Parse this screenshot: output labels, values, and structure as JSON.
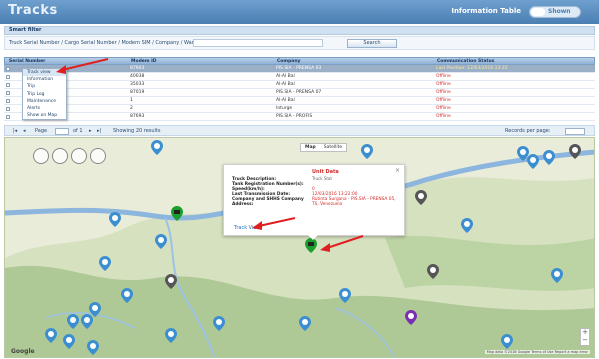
{
  "header": {
    "title": "Tracks",
    "right_label": "Information Table",
    "toggle_label": "Shown"
  },
  "search": {
    "section_title": "Smart filter",
    "label": "Truck Serial Number / Cargo Serial Number / Modem SIM / Company / Warehouse:",
    "value": "",
    "button_label": "Search"
  },
  "table": {
    "columns": [
      "Serial Number",
      "Modem ID",
      "Company",
      "Communication Status"
    ],
    "rows": [
      {
        "id": "1",
        "serial": "",
        "modem": "87903",
        "company": "PIS.SIA - PRENSA 03",
        "status": "Last Position: 12/03/2016 13:22",
        "selected": true
      },
      {
        "id": "2",
        "serial": "",
        "modem": "40038",
        "company": "Al-Al Bal",
        "status": "Offline"
      },
      {
        "id": "3",
        "serial": "",
        "modem": "35033",
        "company": "Al-Al Bal",
        "status": "Offline"
      },
      {
        "id": "4",
        "serial": "",
        "modem": "87019",
        "company": "PIS.SIA - PRENSA 07",
        "status": "Offline"
      },
      {
        "id": "5",
        "serial": "",
        "modem": "1",
        "company": "Al-Al Bal",
        "status": "Offline"
      },
      {
        "id": "6",
        "serial": "",
        "modem": "2",
        "company": "Inturge",
        "status": "Offline"
      },
      {
        "id": "7",
        "serial": "",
        "modem": "87693",
        "company": "PIS.SIA - PROFIS",
        "status": "Offline"
      }
    ]
  },
  "context_menu": {
    "items": [
      "Track view",
      "Information",
      "Trip",
      "Trip Log",
      "Maintenance",
      "Alerts",
      "Show on Map"
    ]
  },
  "pager": {
    "page_label": "Page",
    "page_value": "1",
    "of_label": "of 1",
    "showing": "Showing 20 results",
    "records_label": "Records per page:",
    "records_value": "20"
  },
  "map": {
    "type_buttons": [
      "Map",
      "Satellite"
    ],
    "google_text": "Google",
    "attribution": "Map data ©2016 Google   Terms of Use   Report a map error",
    "zoom_in": "+",
    "zoom_out": "−"
  },
  "info_window": {
    "title": "Unit Data",
    "subtitle": "Truck Stat",
    "labels": [
      "Truck Description:",
      "Tank Registration Number(s):",
      "Speed(km/h):",
      "Last Transmission Date:",
      "Company and SHHS Company",
      "Address:"
    ],
    "values": [
      "0",
      "12/03/2016 13:22:00",
      "Rutinta Surgana - PIS.SIA - PRENSA 05,",
      "TS, Venezuela"
    ],
    "link": "Track View",
    "close": "×"
  },
  "colors": {
    "header": "#4a7fb2",
    "status_offline": "#d42b2b",
    "annotation_arrow": "#e02020",
    "pin_blue": "#3b8fd0",
    "pin_green": "#1b9e2e",
    "pin_purple": "#7a2fb3",
    "pin_dark": "#555555"
  },
  "icons": [
    "pin-blue-icon",
    "pin-green-truck-icon",
    "pin-dark-icon",
    "pin-purple-icon",
    "close-icon",
    "plus-icon",
    "minus-icon"
  ]
}
